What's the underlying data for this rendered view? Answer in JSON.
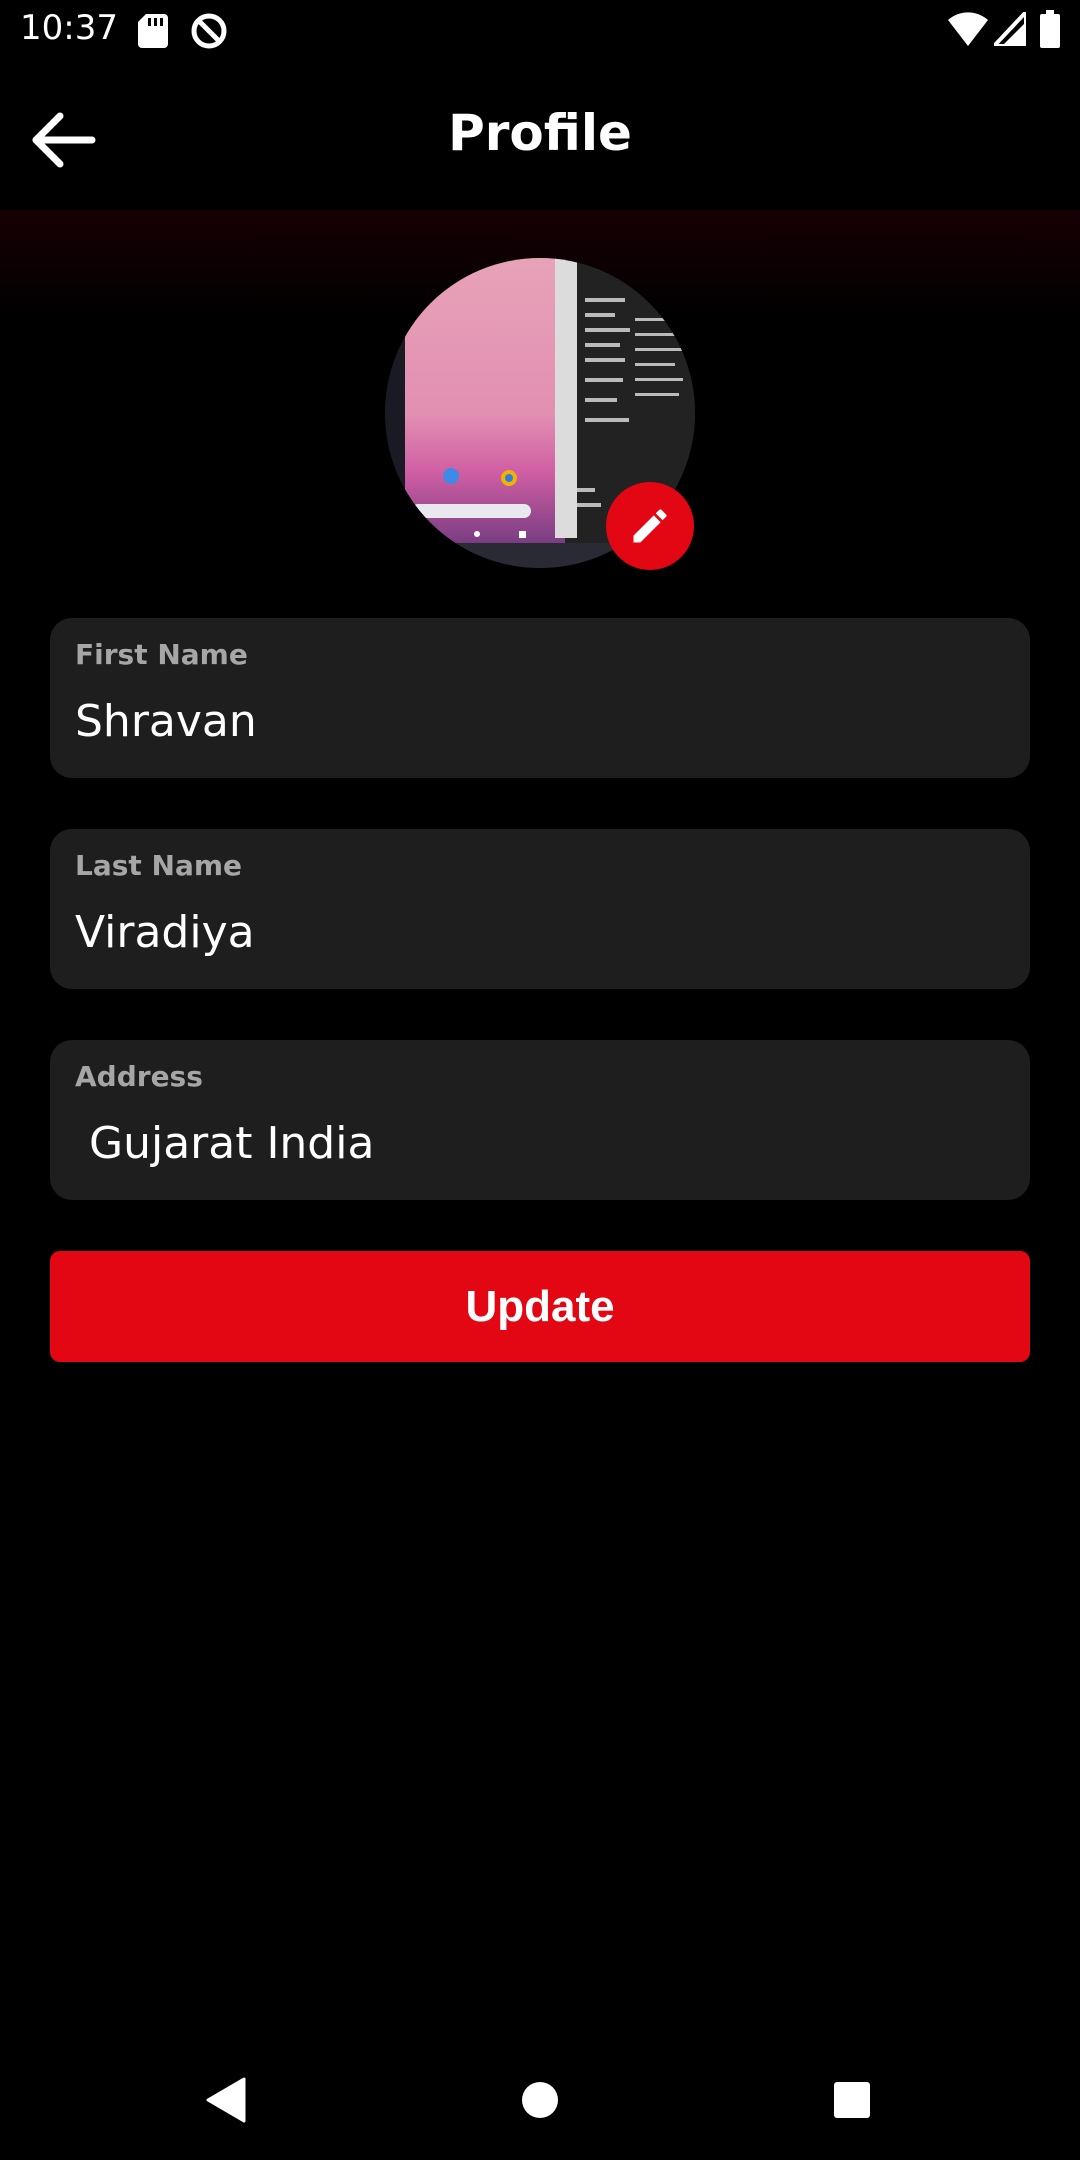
{
  "status_bar": {
    "time": "10:37",
    "icons": [
      "sd-card-icon",
      "data-saver-icon",
      "wifi-icon",
      "signal-icon",
      "battery-icon"
    ]
  },
  "app_bar": {
    "back_icon": "arrow-left-icon",
    "title": "Profile"
  },
  "profile": {
    "edit_icon": "pencil-icon",
    "accent_color": "#e30613"
  },
  "form": {
    "first_name": {
      "label": "First Name",
      "value": "Shravan"
    },
    "last_name": {
      "label": "Last Name",
      "value": "Viradiya"
    },
    "address": {
      "label": "Address",
      "value": " Gujarat India"
    },
    "update_label": "Update"
  },
  "nav_bar": {
    "icons": [
      "back-triangle-icon",
      "home-circle-icon",
      "recents-square-icon"
    ]
  }
}
